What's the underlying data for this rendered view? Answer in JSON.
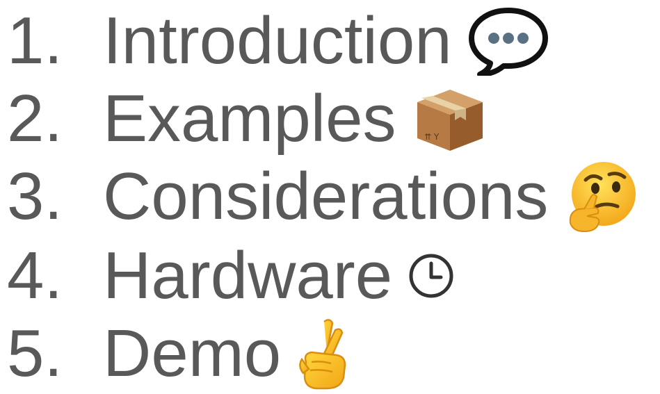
{
  "agenda": {
    "items": [
      {
        "number": "1.",
        "label": "Introduction",
        "icon": "speech-balloon-icon"
      },
      {
        "number": "2.",
        "label": "Examples",
        "icon": "package-icon"
      },
      {
        "number": "3.",
        "label": "Considerations",
        "icon": "thinking-face-icon"
      },
      {
        "number": "4.",
        "label": "Hardware",
        "icon": "clock-icon"
      },
      {
        "number": "5.",
        "label": "Demo",
        "icon": "crossed-fingers-icon"
      }
    ]
  },
  "colors": {
    "text": "#595959",
    "background": "#ffffff"
  }
}
